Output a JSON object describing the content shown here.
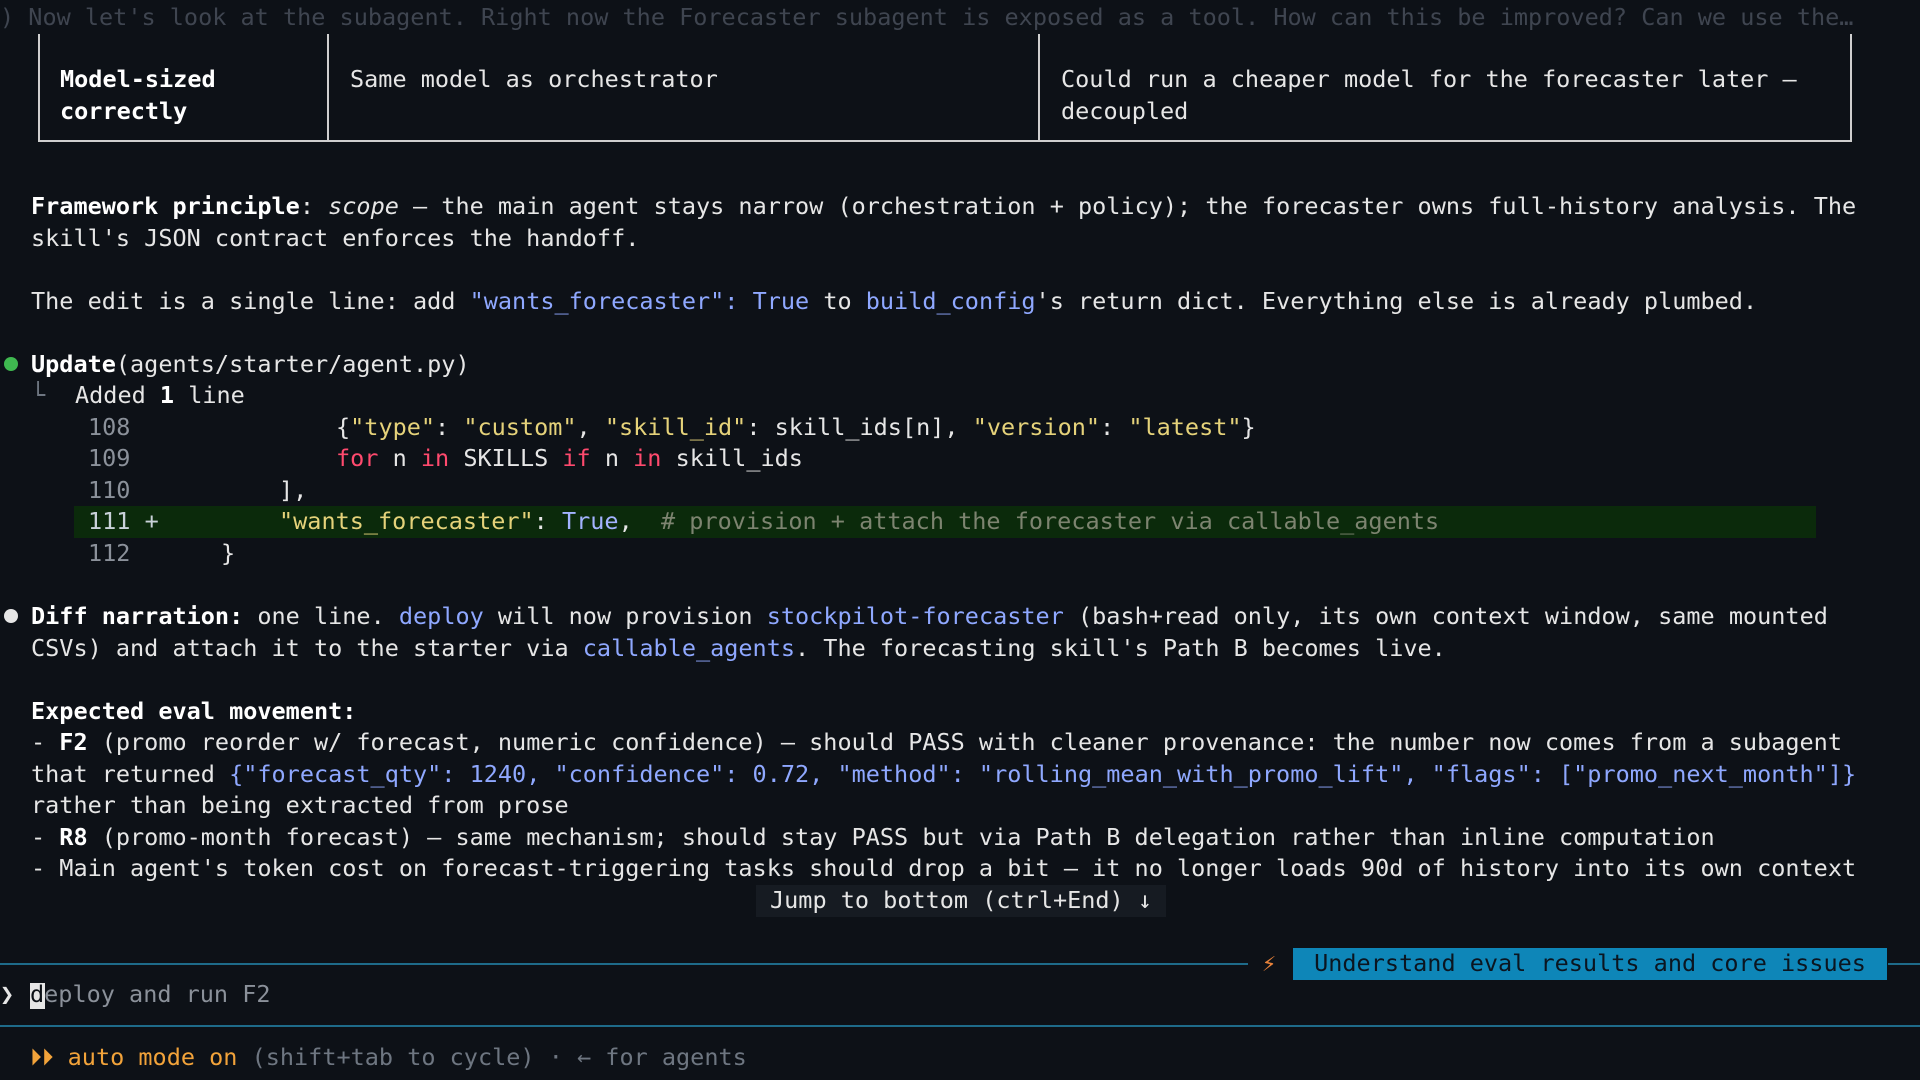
{
  "top_echo": ") Now let's look at the subagent. Right now the Forecaster subagent is exposed as a tool. How can this be improved? Can we use the…",
  "table": {
    "row_label_1": "Model-sized",
    "row_label_2": "correctly",
    "col2": "Same model as orchestrator",
    "col3_1": "Could run a cheaper model for the forecaster later —",
    "col3_2": "decoupled"
  },
  "framework": {
    "label": "Framework principle",
    "colon": ": ",
    "scope": "scope",
    "rest1": " — the main agent stays narrow (orchestration + policy); the forecaster owns full-history analysis. The",
    "line2": "skill's JSON contract enforces the handoff."
  },
  "edit_line": {
    "pre": "The edit is a single line: add ",
    "key": "\"wants_forecaster\": True",
    "mid": " to ",
    "func": "build_config",
    "post": "'s return dict. Everything else is already plumbed."
  },
  "update": {
    "verb": "Update",
    "path": "(agents/starter/agent.py)",
    "tree": "└",
    "added_pre": "Added ",
    "added_n": "1",
    "added_post": " line"
  },
  "diff": {
    "l108": "108",
    "l109": "109",
    "l110": "110",
    "l111": "111 +",
    "l112": "112",
    "c108_a": "{",
    "c108_b": "\"type\"",
    "c108_c": ": ",
    "c108_d": "\"custom\"",
    "c108_e": ", ",
    "c108_f": "\"skill_id\"",
    "c108_g": ": skill_ids[n], ",
    "c108_h": "\"version\"",
    "c108_i": ": ",
    "c108_j": "\"latest\"",
    "c108_k": "}",
    "c109_for": "for",
    "c109_n": " n ",
    "c109_in": "in",
    "c109_sk": " SKILLS ",
    "c109_if": "if",
    "c109_n2": " n ",
    "c109_in2": "in",
    "c109_ids": " skill_ids",
    "c110": "],",
    "c111_key": "\"wants_forecaster\"",
    "c111_colon": ": ",
    "c111_true": "True",
    "c111_comma": ",  ",
    "c111_cmt": "# provision + attach the forecaster via callable_agents",
    "c112": "}"
  },
  "narration": {
    "label": "Diff narration:",
    "t1": " one line. ",
    "deploy": "deploy",
    "t2": " will now provision ",
    "forecaster": "stockpilot-forecaster",
    "t3": " (bash+read only, its own context window, same mounted",
    "line2_pre": "CSVs) and attach it to the starter via ",
    "callable": "callable_agents",
    "line2_post": ". The forecasting skill's Path B becomes live."
  },
  "eval": {
    "heading": "Expected eval movement:",
    "f2_dash": "- ",
    "f2": "F2",
    "f2_rest": " (promo reorder w/ forecast, numeric confidence) — should PASS with cleaner provenance: the number now comes from a subagent",
    "f2_l2_pre": "that returned ",
    "f2_json": "{\"forecast_qty\": 1240, \"confidence\": 0.72, \"method\": \"rolling_mean_with_promo_lift\", \"flags\": [\"promo_next_month\"]}",
    "f2_l3": "rather than being extracted from prose",
    "r8_dash": "- ",
    "r8": "R8",
    "r8_rest": " (promo-month forecast) — same mechanism; should stay PASS but via Path B delegation rather than inline computation",
    "cost": "- Main agent's token cost on forecast-triggering tasks should drop a bit — it no longer loads 90d of history into its own context"
  },
  "jump": "Jump to bottom (ctrl+End) ↓",
  "task_badge": "Understand eval results and core issues",
  "input": {
    "caret": "❯",
    "first_char": "d",
    "rest": "eploy and run F2"
  },
  "mode": {
    "arrows": "⏵⏵ ",
    "label": "auto mode on",
    "hint": " (shift+tab to cycle) · ← for agents"
  },
  "colors": {
    "background": "#0d1117",
    "code_blue": "#8fa8ff",
    "string_yellow": "#e5d27a",
    "keyword_red": "#ff4a6e",
    "added_green": "#0b2a0b",
    "badge_blue": "#0e86b8",
    "success_dot": "#3fb950",
    "accent_orange": "#f2a33a"
  }
}
